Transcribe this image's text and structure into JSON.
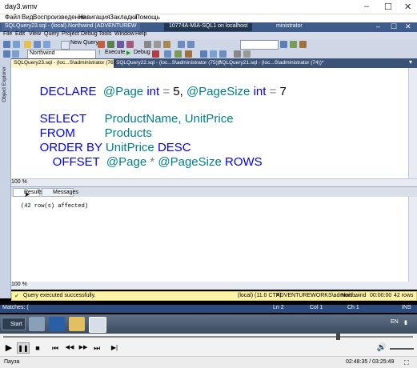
{
  "player": {
    "title": "day3.wmv",
    "menu": [
      "Файл",
      "Вид",
      "Воспроизведение",
      "Навигация",
      "Закладки",
      "Помощь"
    ],
    "status": "Пауза",
    "time": "02:48:35 / 03:25:49",
    "window_controls": {
      "minimize": "–",
      "maximize": "☐",
      "close": "✕"
    }
  },
  "ssms": {
    "tab_title": "SQLQuery23.sql - (local).Northwind (ADVENTUREW",
    "window_caption": "10774A-MIA-SQL1 on localhost",
    "title_suffix": "ministrator",
    "menu": [
      "File",
      "Edit",
      "View",
      "Query",
      "Project",
      "Debug",
      "Tools",
      "Window",
      "Help"
    ],
    "toolbar": {
      "new_query": "New Query",
      "execute": "Execute",
      "debug": "Debug",
      "database": "Northwind"
    },
    "object_explorer": "Object Explorer",
    "doc_tabs": [
      "SQLQuery23.sql - (loc...S\\administrator (76))*",
      "SQLQuery22.sql - (loc...S\\administrator (75))*",
      "SQLQuery21.sql - (loc...S\\administrator (74))*"
    ],
    "code": {
      "l1": {
        "kw1": "DECLARE",
        "var1": "@Page",
        "t1": "int",
        "eq1": "=",
        "n1": "5,",
        "var2": "@PageSize",
        "t2": "int",
        "eq2": "=",
        "n2": "7"
      },
      "l2": {
        "kw": "SELECT",
        "cols": "ProductName, UnitPrice"
      },
      "l3": {
        "kw": "FROM",
        "tbl": "Products"
      },
      "l4": {
        "kw": "ORDER BY",
        "col": "UnitPrice",
        "dir": "DESC"
      },
      "l5": {
        "kw": "OFFSET",
        "var1": "@Page",
        "op": "*",
        "var2": "@PageSize",
        "rows": "ROWS"
      }
    },
    "zoom": "100 %",
    "result_tabs": [
      "Results",
      "Messages"
    ],
    "result_message": "(42 row(s) affected)",
    "exec_status": "Query executed successfully.",
    "exec_info": [
      "(local) (11.0 CTP)",
      "ADVENTUREWORKS\\adminis...",
      "Northwind",
      "00:00:00",
      "42 rows"
    ],
    "statusbar": {
      "left": "Matches: (",
      "ln": "Ln 2",
      "col": "Col 1",
      "ch": "Ch 1",
      "ins": "INS"
    }
  },
  "taskbar": {
    "start": "Start",
    "lang": "EN"
  },
  "controls": {
    "play": "▶",
    "pause": "❚❚",
    "stop": "■",
    "prev_chapter": "⏮",
    "rewind": "◀◀",
    "forward": "▶▶",
    "next_chapter": "⏭",
    "frame": "▶|",
    "volume": "🔊"
  }
}
